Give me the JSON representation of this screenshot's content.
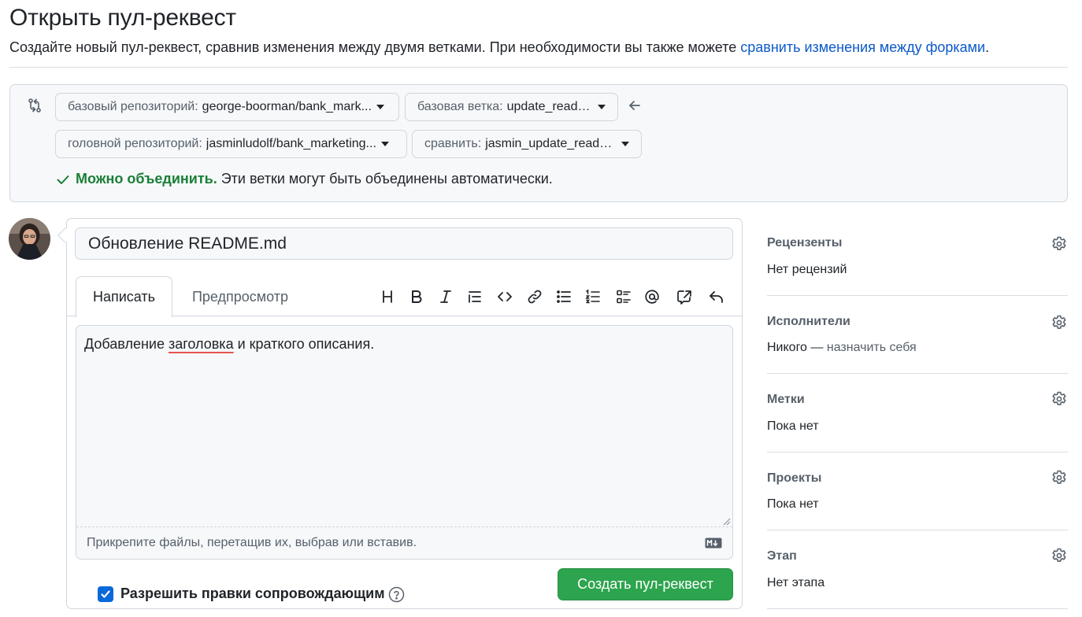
{
  "page": {
    "title": "Открыть пул-реквест",
    "subtitle_text": "Создайте новый пул-реквест, сравнив изменения между двумя ветками. При необходимости вы также можете ",
    "subtitle_link": "сравнить изменения между форками",
    "subtitle_end": "."
  },
  "compare": {
    "base_repo_label": "базовый репозиторий:",
    "base_repo_value": "george-boorman/bank_mark...",
    "base_branch_label": "базовая ветка:",
    "base_branch_value": "update_readme",
    "head_repo_label": "головной репозиторий:",
    "head_repo_value": "jasminludolf/bank_marketing...",
    "compare_label": "сравнить:",
    "compare_value": "jasmin_update_readme",
    "merge_ok": "Можно объединить.",
    "merge_text": "Эти ветки могут быть объединены автоматически."
  },
  "form": {
    "title_value": "Обновление README.md",
    "tab_write": "Написать",
    "tab_preview": "Предпросмотр",
    "body_pre": "Добавление ",
    "body_misspelled": "заголовка",
    "body_post": " и краткого описания.",
    "attach_hint": "Прикрепите файлы, перетащив их, выбрав или вставив.",
    "maintainers_label": "Разрешить правки сопровождающим",
    "maintainers_checked": true,
    "create_button": "Создать пул-реквест"
  },
  "toolbar": [
    "heading-icon",
    "bold-icon",
    "italic-icon",
    "quote-icon",
    "code-icon",
    "link-icon",
    "unordered-list-icon",
    "ordered-list-icon",
    "task-list-icon",
    "mention-icon",
    "reference-icon",
    "undo-icon"
  ],
  "sidebar": {
    "reviewers_title": "Рецензенты",
    "reviewers_value": "Нет рецензий",
    "assignees_title": "Исполнители",
    "assignees_value": "Никого —",
    "assignees_link": "назначить себя",
    "labels_title": "Метки",
    "labels_value": "Пока нет",
    "projects_title": "Проекты",
    "projects_value": "Пока нет",
    "milestone_title": "Этап",
    "milestone_value": "Нет этапа"
  },
  "colors": {
    "accent_link": "#0b59c9",
    "merge_green": "#1a7f37",
    "button_green": "#2da44e",
    "checkbox_blue": "#0969da"
  }
}
